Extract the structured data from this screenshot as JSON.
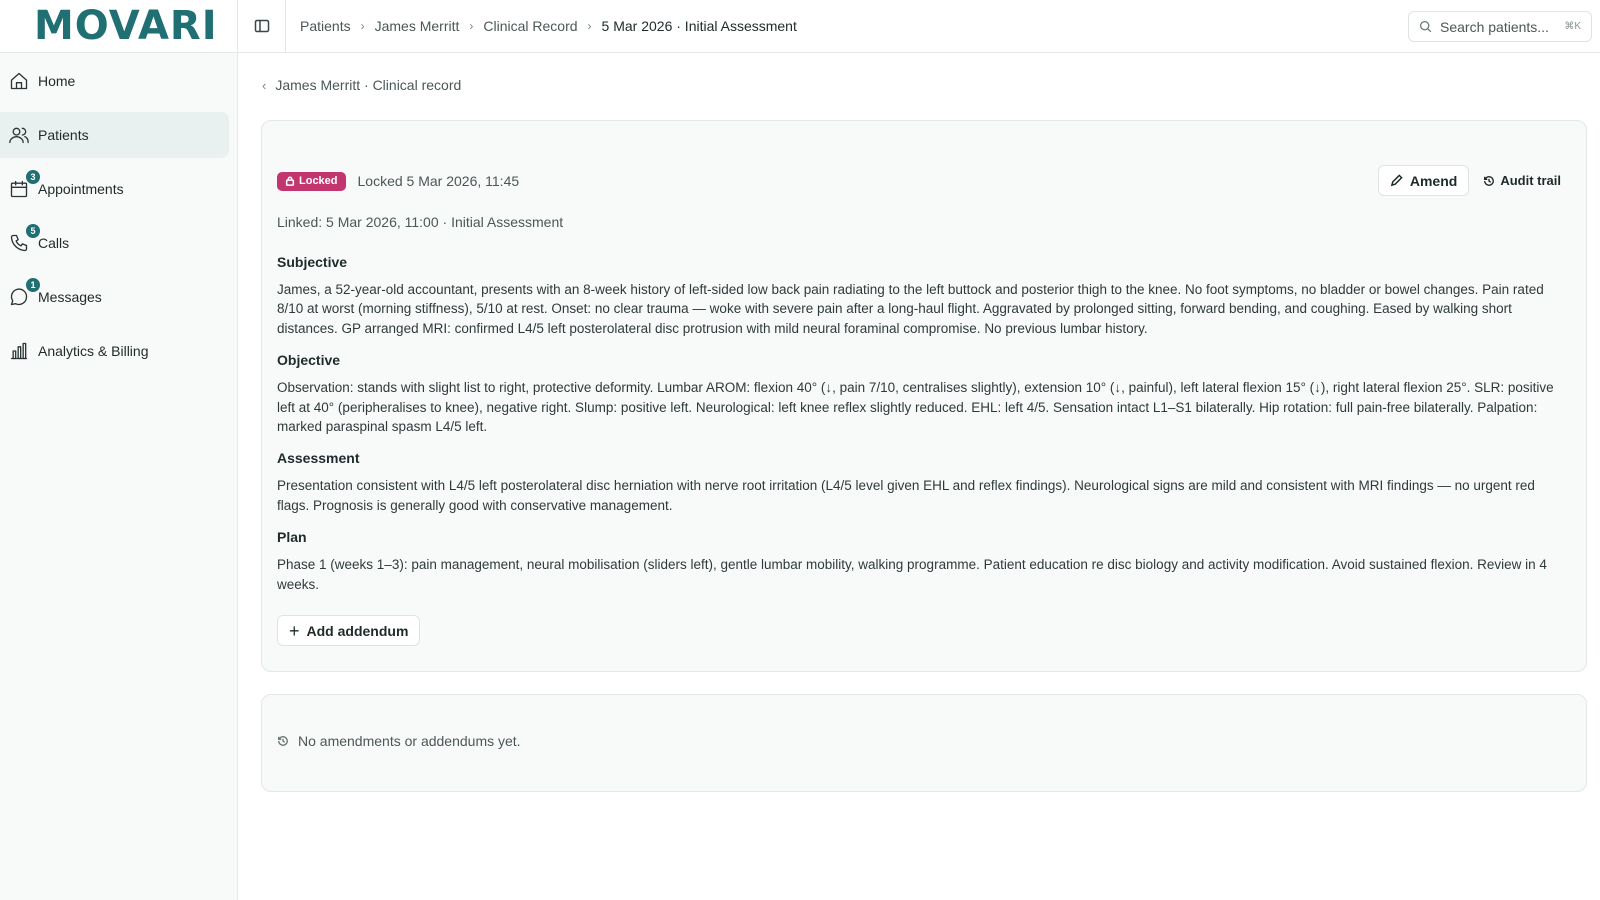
{
  "app": {
    "logo": "MOVARI"
  },
  "sidebar": {
    "items": [
      {
        "label": "Home",
        "icon": "home-icon",
        "badge": ""
      },
      {
        "label": "Patients",
        "icon": "users-icon",
        "badge": "",
        "active": true
      },
      {
        "label": "Appointments",
        "icon": "calendar-icon",
        "badge": "3"
      },
      {
        "label": "Calls",
        "icon": "phone-icon",
        "badge": "5"
      },
      {
        "label": "Messages",
        "icon": "message-icon",
        "badge": "1"
      },
      {
        "label": "Analytics & Billing",
        "icon": "bar-chart-icon",
        "badge": ""
      }
    ]
  },
  "breadcrumb": [
    "Patients",
    "James Merritt",
    "Clinical Record",
    "5 Mar 2026 · Initial Assessment"
  ],
  "search": {
    "placeholder": "Search patients...",
    "shortcut": "⌘K"
  },
  "back_link": "James Merritt · Clinical record",
  "record": {
    "status_badge": "Locked",
    "locked_text": "Locked 5 Mar 2026, 11:45",
    "amend_label": "Amend",
    "audit_label": "Audit trail",
    "linked": "Linked: 5 Mar 2026, 11:00 · Initial Assessment",
    "sections": [
      {
        "title": "Subjective",
        "body": "James, a 52-year-old accountant, presents with an 8-week history of left-sided low back pain radiating to the left buttock and posterior thigh to the knee. No foot symptoms, no bladder or bowel changes. Pain rated 8/10 at worst (morning stiffness), 5/10 at rest. Onset: no clear trauma — woke with severe pain after a long-haul flight. Aggravated by prolonged sitting, forward bending, and coughing. Eased by walking short distances. GP arranged MRI: confirmed L4/5 left posterolateral disc protrusion with mild neural foraminal compromise. No previous lumbar history."
      },
      {
        "title": "Objective",
        "body": "Observation: stands with slight list to right, protective deformity. Lumbar AROM: flexion 40° (↓, pain 7/10, centralises slightly), extension 10° (↓, painful), left lateral flexion 15° (↓), right lateral flexion 25°. SLR: positive left at 40° (peripheralises to knee), negative right. Slump: positive left. Neurological: left knee reflex slightly reduced. EHL: left 4/5. Sensation intact L1–S1 bilaterally. Hip rotation: full pain-free bilaterally. Palpation: marked paraspinal spasm L4/5 left."
      },
      {
        "title": "Assessment",
        "body": "Presentation consistent with L4/5 left posterolateral disc herniation with nerve root irritation (L4/5 level given EHL and reflex findings). Neurological signs are mild and consistent with MRI findings — no urgent red flags. Prognosis is generally good with conservative management."
      },
      {
        "title": "Plan",
        "body": "Phase 1 (weeks 1–3): pain management, neural mobilisation (sliders left), gentle lumbar mobility, walking programme. Patient education re disc biology and activity modification. Avoid sustained flexion. Review in 4 weeks."
      }
    ],
    "addendum_label": "Add addendum"
  },
  "audit": {
    "empty_text": "No amendments or addendums yet."
  },
  "colors": {
    "brand": "#1f6f73",
    "locked": "#c2366d",
    "active_nav": "#e8f1ef"
  }
}
